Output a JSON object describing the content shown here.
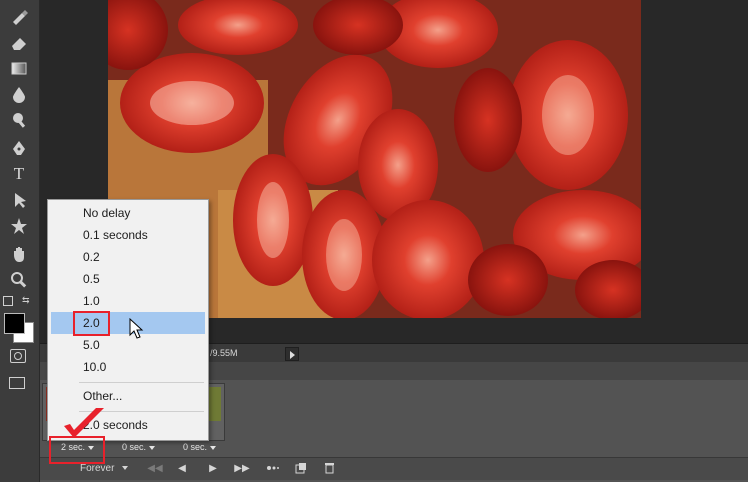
{
  "tools": [
    {
      "icon": "brush-icon"
    },
    {
      "icon": "eraser-icon"
    },
    {
      "icon": "gradient-icon"
    },
    {
      "icon": "blur-drop-icon"
    },
    {
      "icon": "dodge-icon"
    },
    {
      "icon": "pen-icon"
    },
    {
      "icon": "type-icon",
      "glyph": "T"
    },
    {
      "icon": "path-select-icon"
    },
    {
      "icon": "shape-icon"
    },
    {
      "icon": "hand-icon"
    },
    {
      "icon": "zoom-icon"
    }
  ],
  "status": {
    "doc_size": "/9.55M"
  },
  "frames": [
    {
      "delay": "2 sec."
    },
    {
      "delay": "0 sec."
    },
    {
      "delay": "0 sec."
    }
  ],
  "controls": {
    "loop": "Forever"
  },
  "delay_menu": {
    "items": [
      "No delay",
      "0.1 seconds",
      "0.2",
      "0.5",
      "1.0",
      "2.0",
      "5.0",
      "10.0"
    ],
    "selected": "2.0",
    "other": "Other...",
    "current": "2.0 seconds"
  },
  "colors": {
    "highlight": "#a4c8f0",
    "annotation": "#e8212b",
    "panel": "#535353"
  }
}
